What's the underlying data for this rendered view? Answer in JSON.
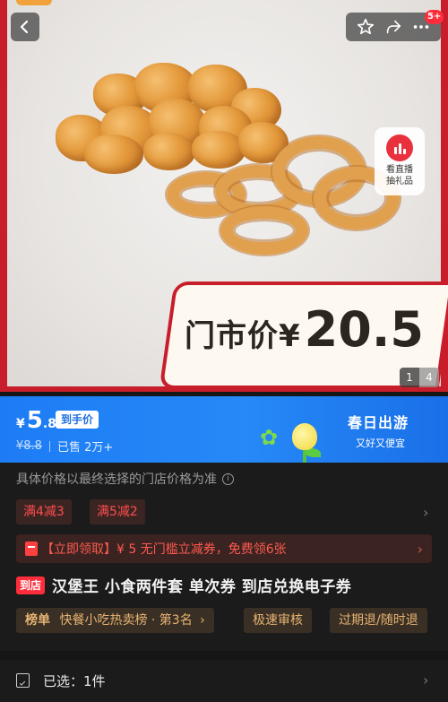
{
  "topbar": {
    "badge_count": "5+"
  },
  "hero": {
    "price_label": "门市价",
    "price_currency": "¥",
    "price_value": "20.5",
    "live_label_line1": "看直播",
    "live_label_line2": "抽礼品",
    "pager_current": "1",
    "pager_total": "4"
  },
  "price_bar": {
    "currency": "¥",
    "price_int": "5",
    "price_dec": ".8",
    "tag": "到手价",
    "original_price": "¥8.8",
    "sold": "已售 2万+",
    "promo_title": "春日出游",
    "promo_sub": "又好又便宜"
  },
  "info": {
    "note": "具体价格以最终选择的门店价格为准",
    "coupons": [
      "满4减3",
      "满5减2"
    ],
    "voucher_text": "【立即领取】¥ 5 无门槛立减券，免费领6张",
    "store_badge": "到店",
    "title": "汉堡王 小食两件套 单次券 到店兑换电子券",
    "ranking_prefix": "榜单",
    "ranking_text": "快餐小吃热卖榜 · 第3名",
    "pill_fast": "极速审核",
    "pill_refund": "过期退/随时退"
  },
  "selected": {
    "label": "已选：1件"
  },
  "colors": {
    "brand_red": "#c81e2b",
    "price_blue": "#1d7cf5",
    "coupon_red": "#ff4d4d",
    "pill_gold": "#e6b473"
  }
}
